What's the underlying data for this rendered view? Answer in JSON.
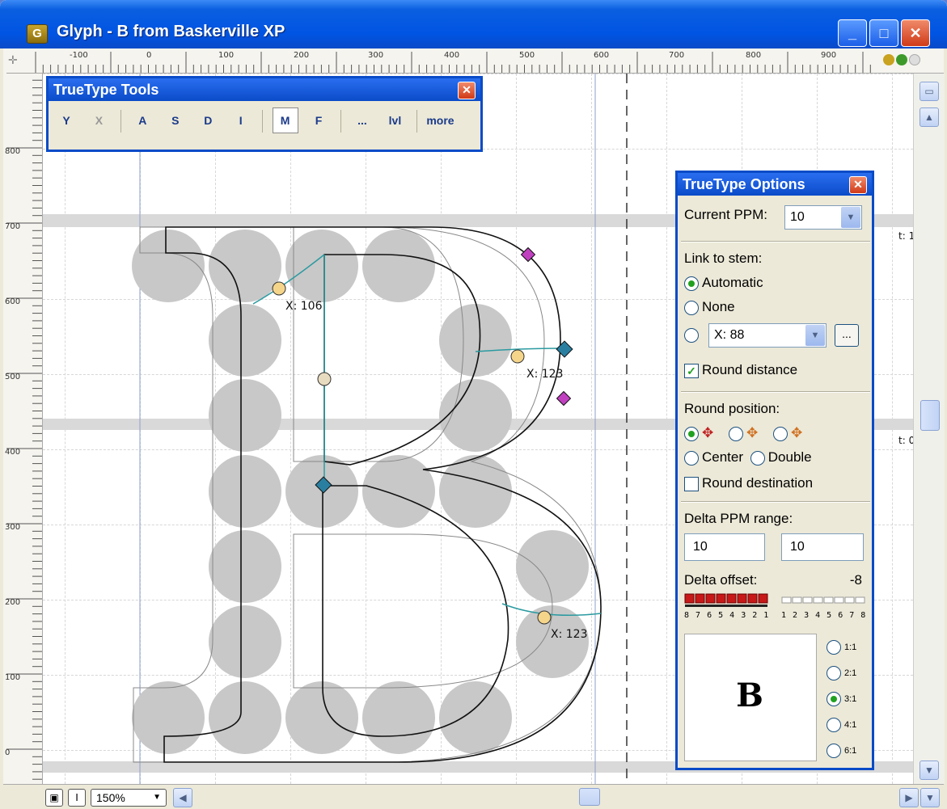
{
  "window": {
    "title": "Glyph - B from Baskerville XP",
    "app_icon": "G",
    "minimize_icon": "minimize-icon",
    "maximize_icon": "maximize-icon",
    "close_icon": "close-icon"
  },
  "ruler": {
    "top_labels": [
      "-100",
      "0",
      "100",
      "200",
      "300",
      "400",
      "500",
      "600",
      "700",
      "800",
      "900"
    ],
    "left_labels": [
      "800",
      "700",
      "600",
      "500",
      "400",
      "300",
      "200",
      "100",
      "0"
    ]
  },
  "canvas": {
    "hint_labels": [
      "X: 106",
      "X: 123",
      "X: 123"
    ],
    "zone_labels": [
      "t: 1",
      "t: 0"
    ]
  },
  "tools_panel": {
    "title": "TrueType Tools",
    "tools": [
      "Y",
      "X",
      "A",
      "S",
      "D",
      "I",
      "M",
      "F",
      "...",
      "lvl",
      "more"
    ]
  },
  "options_panel": {
    "title": "TrueType Options",
    "current_ppm_label": "Current PPM:",
    "current_ppm_value": "10",
    "link_to_stem_label": "Link to stem:",
    "automatic_label": "Automatic",
    "none_label": "None",
    "stem_value": "X: 88",
    "browse_label": "...",
    "round_distance_label": "Round distance",
    "round_position_label": "Round position:",
    "center_label": "Center",
    "double_label": "Double",
    "round_destination_label": "Round destination",
    "delta_ppm_range_label": "Delta PPM range:",
    "delta_from": "10",
    "delta_to": "10",
    "delta_offset_label": "Delta offset:",
    "delta_offset_value": "-8",
    "neg_scale": "8 7 6 5 4 3 2 1",
    "pos_scale": "1 2 3 4 5 6 7 8",
    "preview_char": "B",
    "zoom_options": [
      "1:1",
      "2:1",
      "3:1",
      "4:1",
      "6:1"
    ],
    "zoom_selected": "3:1"
  },
  "status_bar": {
    "zoom": "150%",
    "lock_icon": "lock-icon",
    "cursor_icon": "text-cursor-icon"
  }
}
